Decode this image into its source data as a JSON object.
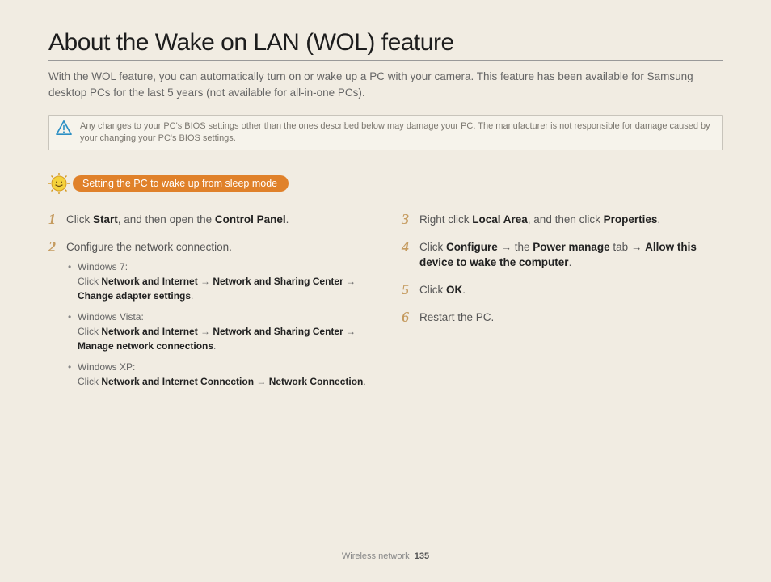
{
  "title": "About the Wake on LAN (WOL) feature",
  "intro": "With the WOL feature, you can automatically turn on or wake up a PC with your camera. This feature has been available for Samsung desktop PCs for the last 5 years (not available for all-in-one PCs).",
  "warning": "Any changes to your PC's BIOS settings other than the ones described below may damage your PC. The manufacturer is not responsible for damage caused by your changing your PC's BIOS settings.",
  "badge": "Setting the PC to wake up from sleep mode",
  "left": {
    "s1_num": "1",
    "s1_a": "Click ",
    "s1_b": "Start",
    "s1_c": ", and then open the ",
    "s1_d": "Control Panel",
    "s1_e": ".",
    "s2_num": "2",
    "s2_a": "Configure the network connection.",
    "w7_label": "Windows 7:",
    "w7_a": "Click ",
    "w7_b": "Network and Internet",
    "w7_c": "Network and Sharing Center",
    "w7_d": "Change adapter settings",
    "wv_label": "Windows Vista:",
    "wv_a": "Click ",
    "wv_b": "Network and Internet",
    "wv_c": "Network and Sharing Center",
    "wv_d": "Manage network connections",
    "wx_label": "Windows XP:",
    "wx_a": "Click ",
    "wx_b": "Network and Internet Connection",
    "wx_c": "Network Connection"
  },
  "right": {
    "s3_num": "3",
    "s3_a": "Right click ",
    "s3_b": "Local Area",
    "s3_c": ", and then click ",
    "s3_d": "Properties",
    "s3_e": ".",
    "s4_num": "4",
    "s4_a": "Click ",
    "s4_b": "Configure",
    "s4_c": " the ",
    "s4_d": "Power manage",
    "s4_e": " tab ",
    "s4_f": "Allow this device to wake the computer",
    "s4_g": ".",
    "s5_num": "5",
    "s5_a": "Click ",
    "s5_b": "OK",
    "s5_c": ".",
    "s6_num": "6",
    "s6_a": "Restart the PC."
  },
  "arrow": "→",
  "dot": ".",
  "footer_label": "Wireless network",
  "footer_page": "135"
}
